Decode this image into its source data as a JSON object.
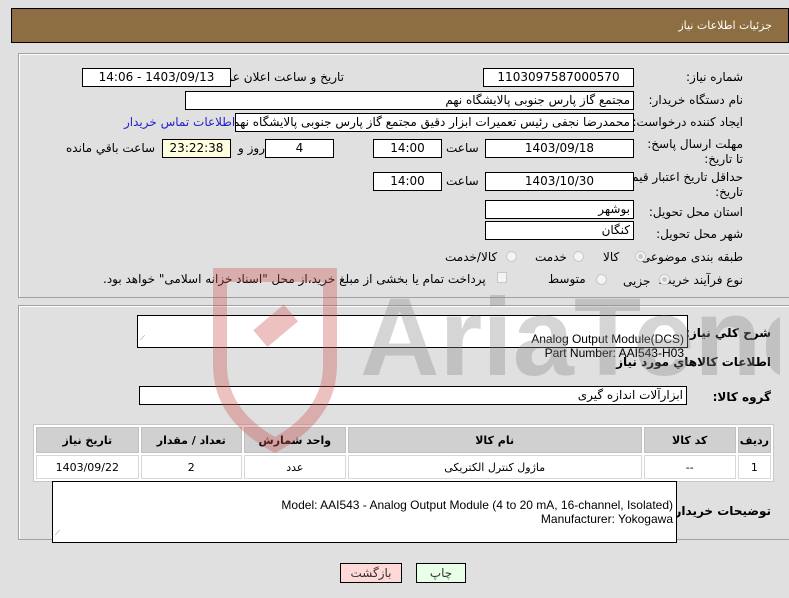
{
  "header": {
    "title": "جزئیات اطلاعات نیاز"
  },
  "form": {
    "need_number": {
      "label": "شماره نیاز:",
      "value": "1103097587000570"
    },
    "announce_datetime": {
      "label": "تاریخ و ساعت اعلان عمومی:",
      "value": "1403/09/13 - 14:06"
    },
    "buyer_org": {
      "label": "نام دستگاه خریدار:",
      "value": "مجتمع گاز پارس جنوبی  پالایشگاه نهم"
    },
    "requester": {
      "label": "ایجاد کننده درخواست:",
      "value": "محمدرضا نجفی رئیس تعمیرات ابزار دقیق مجتمع گاز پارس جنوبی  پالایشگاه نهم",
      "contact_link": "اطلاعات تماس خریدار"
    },
    "response_deadline": {
      "label": "مهلت ارسال پاسخ: تا تاریخ:",
      "date": "1403/09/18",
      "time_label": "ساعت",
      "time": "14:00",
      "days": "4",
      "days_label": "روز و",
      "remaining": "23:22:38",
      "remaining_label": "ساعت باقي مانده"
    },
    "price_validity": {
      "label": "حداقل تاریخ اعتبار قیمت: تا تاریخ:",
      "date": "1403/10/30",
      "time_label": "ساعت",
      "time": "14:00"
    },
    "province": {
      "label": "استان محل تحویل:",
      "value": "بوشهر"
    },
    "city": {
      "label": "شهر محل تحویل:",
      "value": "کنگان"
    },
    "category": {
      "label": "طبقه بندی موضوعی:",
      "options": [
        "کالا",
        "خدمت",
        "کالا/خدمت"
      ],
      "selected": "کالا"
    },
    "purchase_type": {
      "label": "نوع فرآیند خرید :",
      "options": [
        "جزیی",
        "متوسط"
      ],
      "selected": "جزیی",
      "treasury_note": "پرداخت تمام یا بخشی از مبلغ خرید،از محل \"اسناد خزانه اسلامی\" خواهد بود."
    }
  },
  "details": {
    "description_label": "شرح کلي نیاز:",
    "description": "Analog Output Module(DCS)\nPart Number: AAI543-H03",
    "items_heading": "اطلاعات کالاهاي مورد نیاز",
    "group_label": "گروه کالا:",
    "group_value": "ابزارآلات اندازه گیری",
    "table": {
      "headers": [
        "ردیف",
        "کد کالا",
        "نام کالا",
        "واحد شمارش",
        "تعداد / مقدار",
        "تاریخ نیاز"
      ],
      "rows": [
        [
          "1",
          "--",
          "ماژول کنترل الکتریکی",
          "عدد",
          "2",
          "1403/09/22"
        ]
      ]
    },
    "buyer_notes_label": "توضیحات خریدار:",
    "buyer_notes": "Model: AAI543 - Analog Output Module (4 to 20 mA, 16-channel, Isolated)\nManufacturer: Yokogawa"
  },
  "buttons": {
    "print": "چاپ",
    "back": "بازگشت"
  },
  "watermark": "AriaTender.net"
}
